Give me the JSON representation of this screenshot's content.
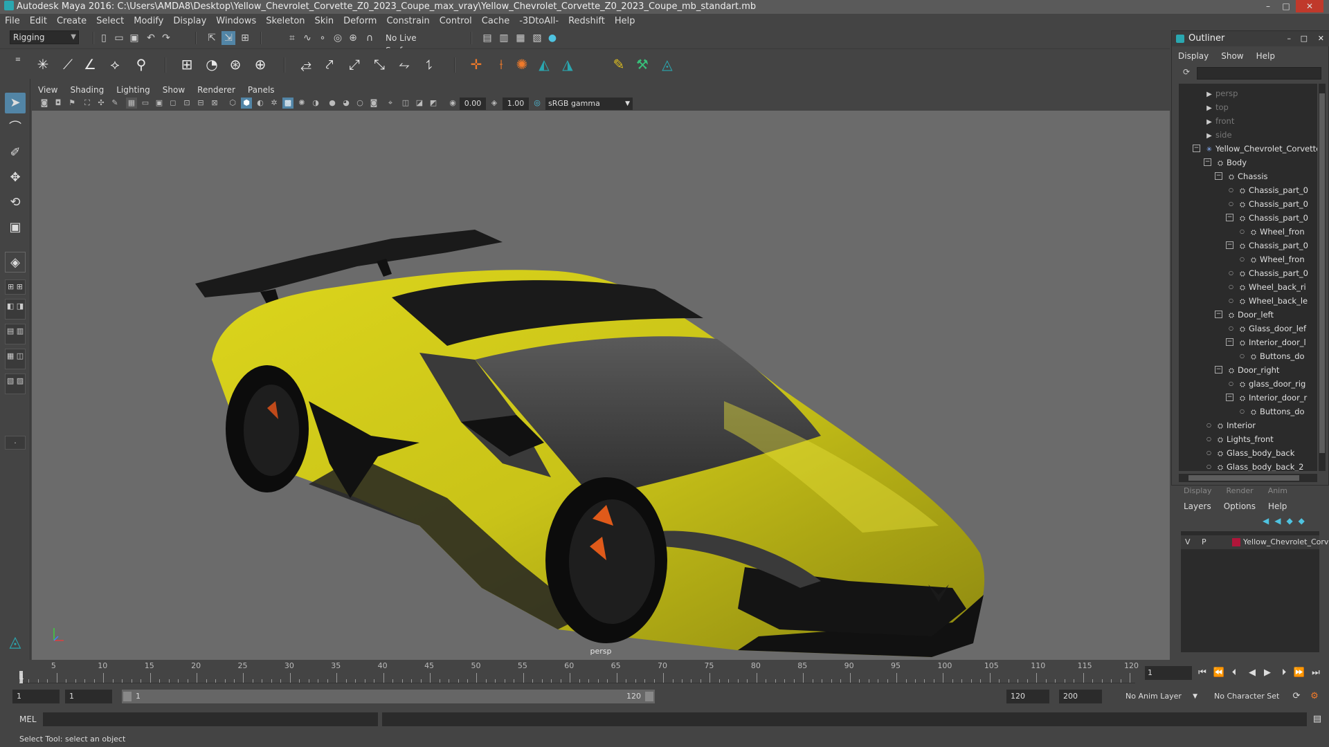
{
  "window": {
    "title": "Autodesk Maya 2016: C:\\Users\\AMDA8\\Desktop\\Yellow_Chevrolet_Corvette_Z0_2023_Coupe_max_vray\\Yellow_Chevrolet_Corvette_Z0_2023_Coupe_mb_standart.mb",
    "controls": [
      "–",
      "□",
      "✕"
    ]
  },
  "menubar": [
    "File",
    "Edit",
    "Create",
    "Select",
    "Modify",
    "Display",
    "Windows",
    "Skeleton",
    "Skin",
    "Deform",
    "Constrain",
    "Control",
    "Cache",
    "-3DtoAll-",
    "Redshift",
    "Help"
  ],
  "statusline": {
    "menuset": "Rigging",
    "live_surface": "No Live Surface"
  },
  "panel": {
    "menus": [
      "View",
      "Shading",
      "Lighting",
      "Show",
      "Renderer",
      "Panels"
    ],
    "exposure": "0.00",
    "gamma": "1.00",
    "color_space": "sRGB gamma",
    "camera": "persp"
  },
  "outliner": {
    "title": "Outliner",
    "menu": [
      "Display",
      "Show",
      "Help"
    ],
    "items": [
      {
        "label": "persp",
        "depth": 0,
        "type": "camera",
        "dim": true
      },
      {
        "label": "top",
        "depth": 0,
        "type": "camera",
        "dim": true
      },
      {
        "label": "front",
        "depth": 0,
        "type": "camera",
        "dim": true
      },
      {
        "label": "side",
        "depth": 0,
        "type": "camera",
        "dim": true
      },
      {
        "label": "Yellow_Chevrolet_Corvette",
        "depth": 0,
        "type": "root"
      },
      {
        "label": "Body",
        "depth": 1,
        "type": "group"
      },
      {
        "label": "Chassis",
        "depth": 2,
        "type": "group"
      },
      {
        "label": "Chassis_part_0",
        "depth": 3,
        "type": "mesh"
      },
      {
        "label": "Chassis_part_0",
        "depth": 3,
        "type": "mesh"
      },
      {
        "label": "Chassis_part_0",
        "depth": 3,
        "type": "group"
      },
      {
        "label": "Wheel_fron",
        "depth": 4,
        "type": "mesh"
      },
      {
        "label": "Chassis_part_0",
        "depth": 3,
        "type": "group"
      },
      {
        "label": "Wheel_fron",
        "depth": 4,
        "type": "mesh"
      },
      {
        "label": "Chassis_part_0",
        "depth": 3,
        "type": "mesh"
      },
      {
        "label": "Wheel_back_ri",
        "depth": 3,
        "type": "mesh"
      },
      {
        "label": "Wheel_back_le",
        "depth": 3,
        "type": "mesh"
      },
      {
        "label": "Door_left",
        "depth": 2,
        "type": "group"
      },
      {
        "label": "Glass_door_lef",
        "depth": 3,
        "type": "mesh"
      },
      {
        "label": "Interior_door_l",
        "depth": 3,
        "type": "group"
      },
      {
        "label": "Buttons_do",
        "depth": 4,
        "type": "mesh"
      },
      {
        "label": "Door_right",
        "depth": 2,
        "type": "group"
      },
      {
        "label": "glass_door_rig",
        "depth": 3,
        "type": "mesh"
      },
      {
        "label": "Interior_door_r",
        "depth": 3,
        "type": "group"
      },
      {
        "label": "Buttons_do",
        "depth": 4,
        "type": "mesh"
      },
      {
        "label": "Interior",
        "depth": 1,
        "type": "mesh"
      },
      {
        "label": "Lights_front",
        "depth": 1,
        "type": "mesh"
      },
      {
        "label": "Glass_body_back",
        "depth": 1,
        "type": "mesh"
      },
      {
        "label": "Glass_body_back_2",
        "depth": 1,
        "type": "mesh"
      }
    ]
  },
  "layers": {
    "tabs": [
      "Display",
      "Render",
      "Anim"
    ],
    "menu": [
      "Layers",
      "Options",
      "Help"
    ],
    "row": {
      "v": "V",
      "p": "P",
      "name": "Yellow_Chevrolet_Corv",
      "color": "#b0163a"
    }
  },
  "timeline": {
    "ticks": [
      "5",
      "10",
      "15",
      "20",
      "25",
      "30",
      "35",
      "40",
      "45",
      "50",
      "55",
      "60",
      "65",
      "70",
      "75",
      "80",
      "85",
      "90",
      "95",
      "100",
      "105",
      "110",
      "115",
      "120"
    ],
    "start_label": "1",
    "current_frame": "1"
  },
  "range": {
    "start": "1",
    "playback_start": "1",
    "slider_start": "1",
    "slider_end": "120",
    "playback_end": "120",
    "end": "200",
    "anim_layer": "No Anim Layer",
    "character_set": "No Character Set"
  },
  "command": {
    "label": "MEL"
  },
  "help_line": "Select Tool: select an object",
  "colors": {
    "car_body": "#c9c318",
    "accent": "#5285a6",
    "viewport_bg": "#6b6b6b"
  }
}
